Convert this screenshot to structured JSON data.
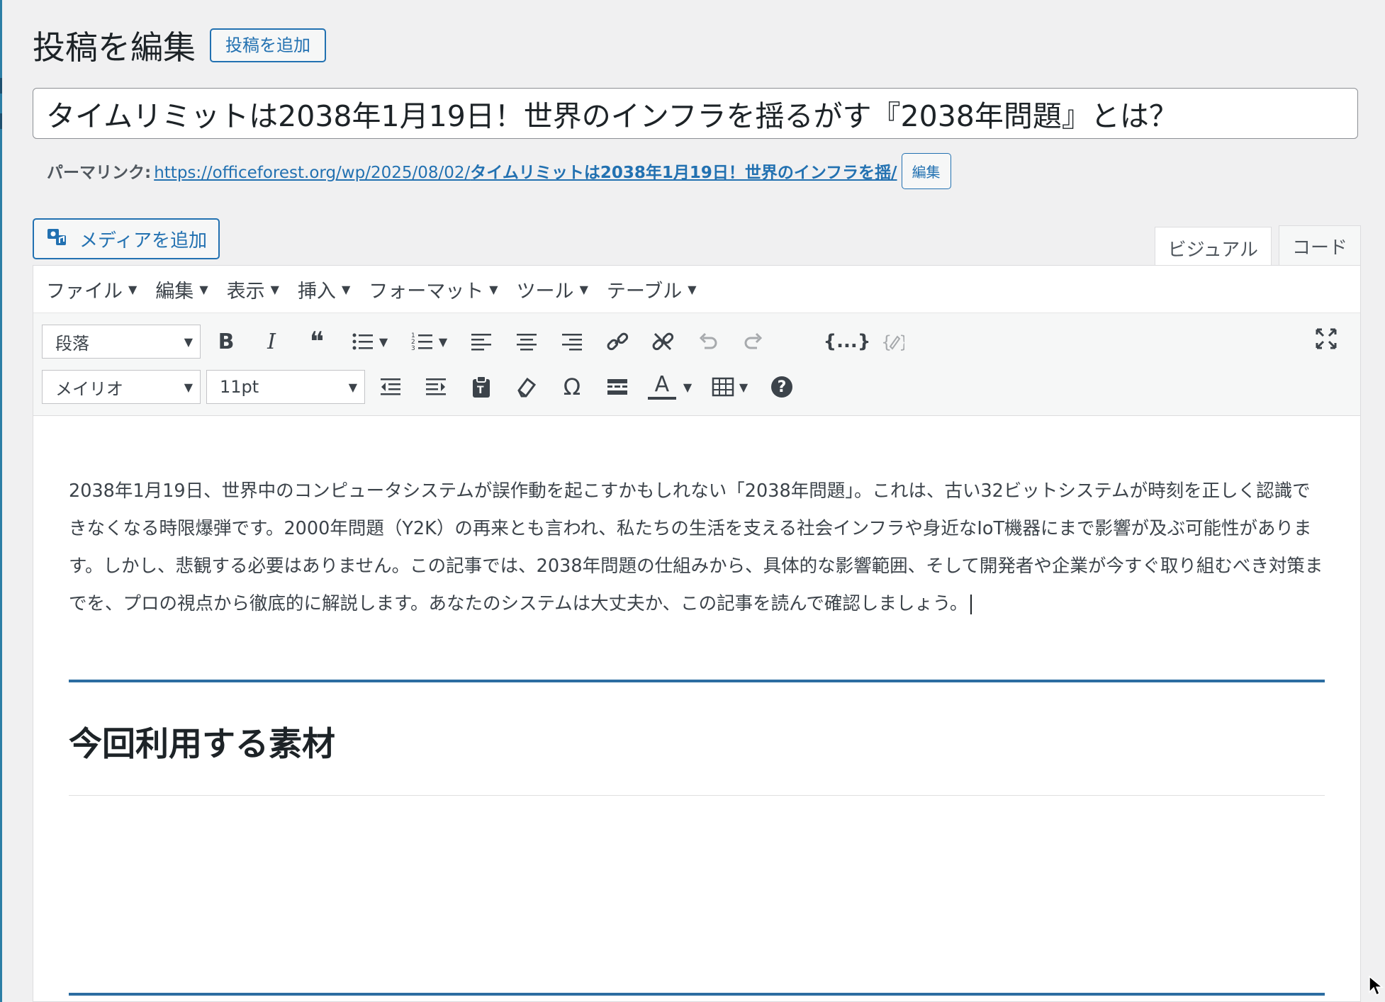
{
  "header": {
    "page_title": "投稿を編集",
    "add_new_label": "投稿を追加"
  },
  "post": {
    "title": "タイムリミットは2038年1月19日！世界のインフラを揺るがす『2038年問題』とは？",
    "permalink_label": "パーマリンク:",
    "permalink_base": "https://officeforest.org/wp/2025/08/02/",
    "permalink_slug": "タイムリミットは2038年1月19日！世界のインフラを揺/",
    "permalink_edit_label": "編集"
  },
  "editor": {
    "add_media_label": "メディアを追加",
    "tabs": [
      {
        "label": "ビジュアル",
        "active": true
      },
      {
        "label": "コード",
        "active": false
      }
    ],
    "menu": [
      "ファイル",
      "編集",
      "表示",
      "挿入",
      "フォーマット",
      "ツール",
      "テーブル"
    ],
    "format_select": "段落",
    "font_select": "メイリオ",
    "size_select": "11pt",
    "icons_row1": [
      "bold-icon",
      "italic-icon",
      "blockquote-icon",
      "bullet-list-icon",
      "numbered-list-icon",
      "align-left-icon",
      "align-center-icon",
      "align-right-icon",
      "link-icon",
      "unlink-icon",
      "undo-icon",
      "redo-icon",
      "code-icon",
      "edit-code-icon",
      "fullscreen-icon"
    ],
    "icons_row2": [
      "outdent-icon",
      "indent-icon",
      "paste-text-icon",
      "clear-format-icon",
      "special-char-icon",
      "read-more-icon",
      "text-color-icon",
      "table-icon",
      "help-icon"
    ],
    "glyphs": {
      "bold": "B",
      "italic": "I",
      "quote": "❝",
      "code": "{...}",
      "omega": "Ω",
      "text_color": "A",
      "help": "?"
    }
  },
  "content": {
    "paragraph": "2038年1月19日、世界中のコンピュータシステムが誤作動を起こすかもしれない「2038年問題」。これは、古い32ビットシステムが時刻を正しく認識できなくなる時限爆弾です。2000年問題（Y2K）の再来とも言われ、私たちの生活を支える社会インフラや身近なIoT機器にまで影響が及ぶ可能性があります。しかし、悲観する必要はありません。この記事では、2038年問題の仕組みから、具体的な影響範囲、そして開発者や企業が今すぐ取り組むべき対策までを、プロの視点から徹底的に解説します。あなたのシステムは大丈夫か、この記事を読んで確認しましょう。",
    "heading": "今回利用する素材"
  },
  "colors": {
    "accent": "#2271b1",
    "rule": "#2c6da1",
    "text": "#3c434a"
  }
}
